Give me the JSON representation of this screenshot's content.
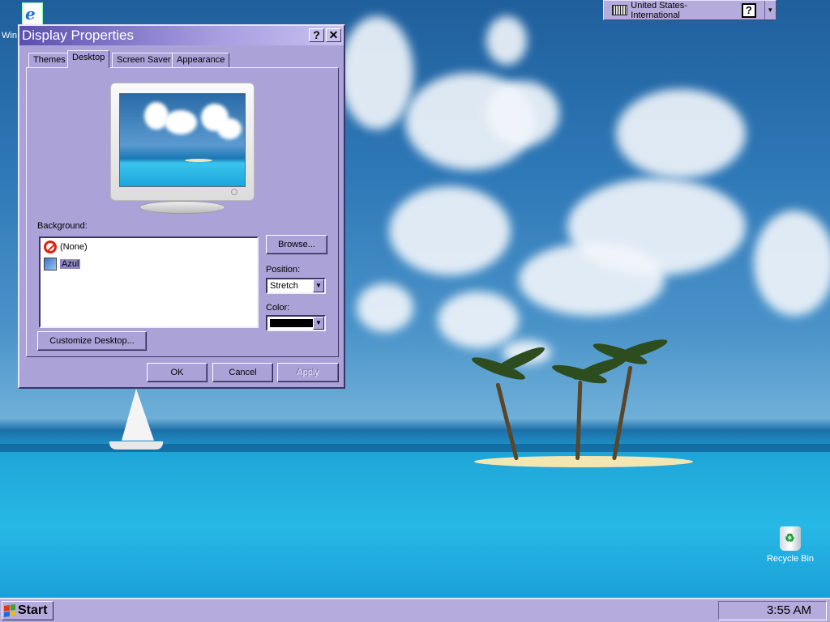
{
  "desktop": {
    "icons": [
      {
        "label": "Win"
      },
      {
        "label": "Recycle Bin"
      }
    ]
  },
  "language_bar": {
    "language": "United States-International",
    "help_glyph": "?",
    "menu_glyph": "▾"
  },
  "dialog": {
    "title": "Display Properties",
    "help_button": "?",
    "close_button": "✕",
    "tabs": [
      {
        "label": "Themes",
        "active": false
      },
      {
        "label": "Desktop",
        "active": true
      },
      {
        "label": "Screen Saver",
        "active": false
      },
      {
        "label": "Appearance",
        "active": false
      }
    ],
    "background_label": "Background:",
    "backgrounds": [
      {
        "label": "(None)",
        "icon": "no-wallpaper-icon",
        "selected": false
      },
      {
        "label": "Azul",
        "icon": "image-file-icon",
        "selected": true
      }
    ],
    "browse_button": "Browse...",
    "position_label": "Position:",
    "position_value": "Stretch",
    "color_label": "Color:",
    "color_value": "#000000",
    "customize_button": "Customize Desktop...",
    "ok_button": "OK",
    "cancel_button": "Cancel",
    "apply_button": "Apply"
  },
  "taskbar": {
    "start_label": "Start",
    "clock": "3:55 AM"
  },
  "colors": {
    "dialog_face": "#aba2d8",
    "taskbar_face": "#b5abdc",
    "title_gradient_start": "#5b4fb0",
    "list_selection": "#8f86c8"
  }
}
